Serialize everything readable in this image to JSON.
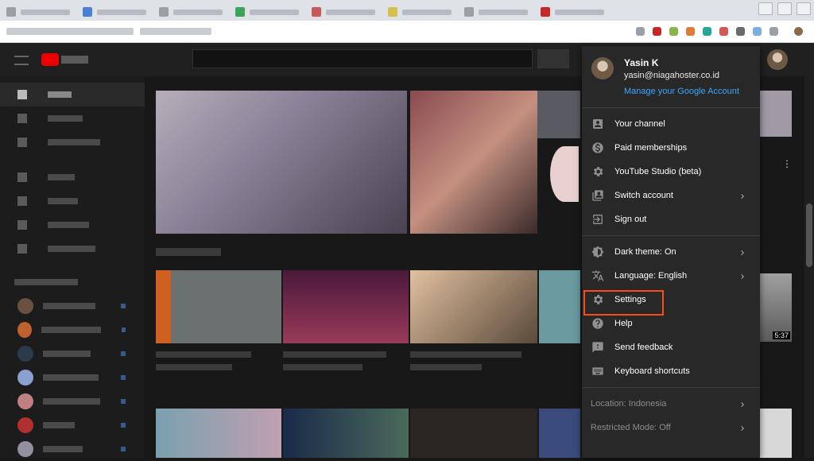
{
  "header": {
    "search": {
      "placeholder": ""
    }
  },
  "account": {
    "name": "Yasin K",
    "email": "yasin@niagahoster.co.id",
    "manage_link": "Manage your Google Account"
  },
  "menu_section_1": [
    {
      "label": "Your channel",
      "icon": "account-box-icon",
      "chevron": false
    },
    {
      "label": "Paid memberships",
      "icon": "dollar-icon",
      "chevron": false
    },
    {
      "label": "YouTube Studio (beta)",
      "icon": "gear-icon",
      "chevron": false
    },
    {
      "label": "Switch account",
      "icon": "switch-account-icon",
      "chevron": true
    },
    {
      "label": "Sign out",
      "icon": "sign-out-icon",
      "chevron": false
    }
  ],
  "menu_section_2": [
    {
      "label": "Dark theme: On",
      "icon": "dark-theme-icon",
      "chevron": true
    },
    {
      "label": "Language: English",
      "icon": "translate-icon",
      "chevron": true
    },
    {
      "label": "Settings",
      "icon": "gear-icon",
      "chevron": false,
      "highlighted": true
    },
    {
      "label": "Help",
      "icon": "help-icon",
      "chevron": false
    },
    {
      "label": "Send feedback",
      "icon": "feedback-icon",
      "chevron": false
    },
    {
      "label": "Keyboard shortcuts",
      "icon": "keyboard-icon",
      "chevron": false
    }
  ],
  "menu_section_3": [
    {
      "label": "Location: Indonesia",
      "chevron": true
    },
    {
      "label": "Restricted Mode: Off",
      "chevron": true
    }
  ],
  "video": {
    "duration": "5:37"
  },
  "colors": {
    "menu_bg": "#282828",
    "accent_blue": "#3ea6ff",
    "highlight": "#ff4b14",
    "page_bg": "#181818"
  }
}
